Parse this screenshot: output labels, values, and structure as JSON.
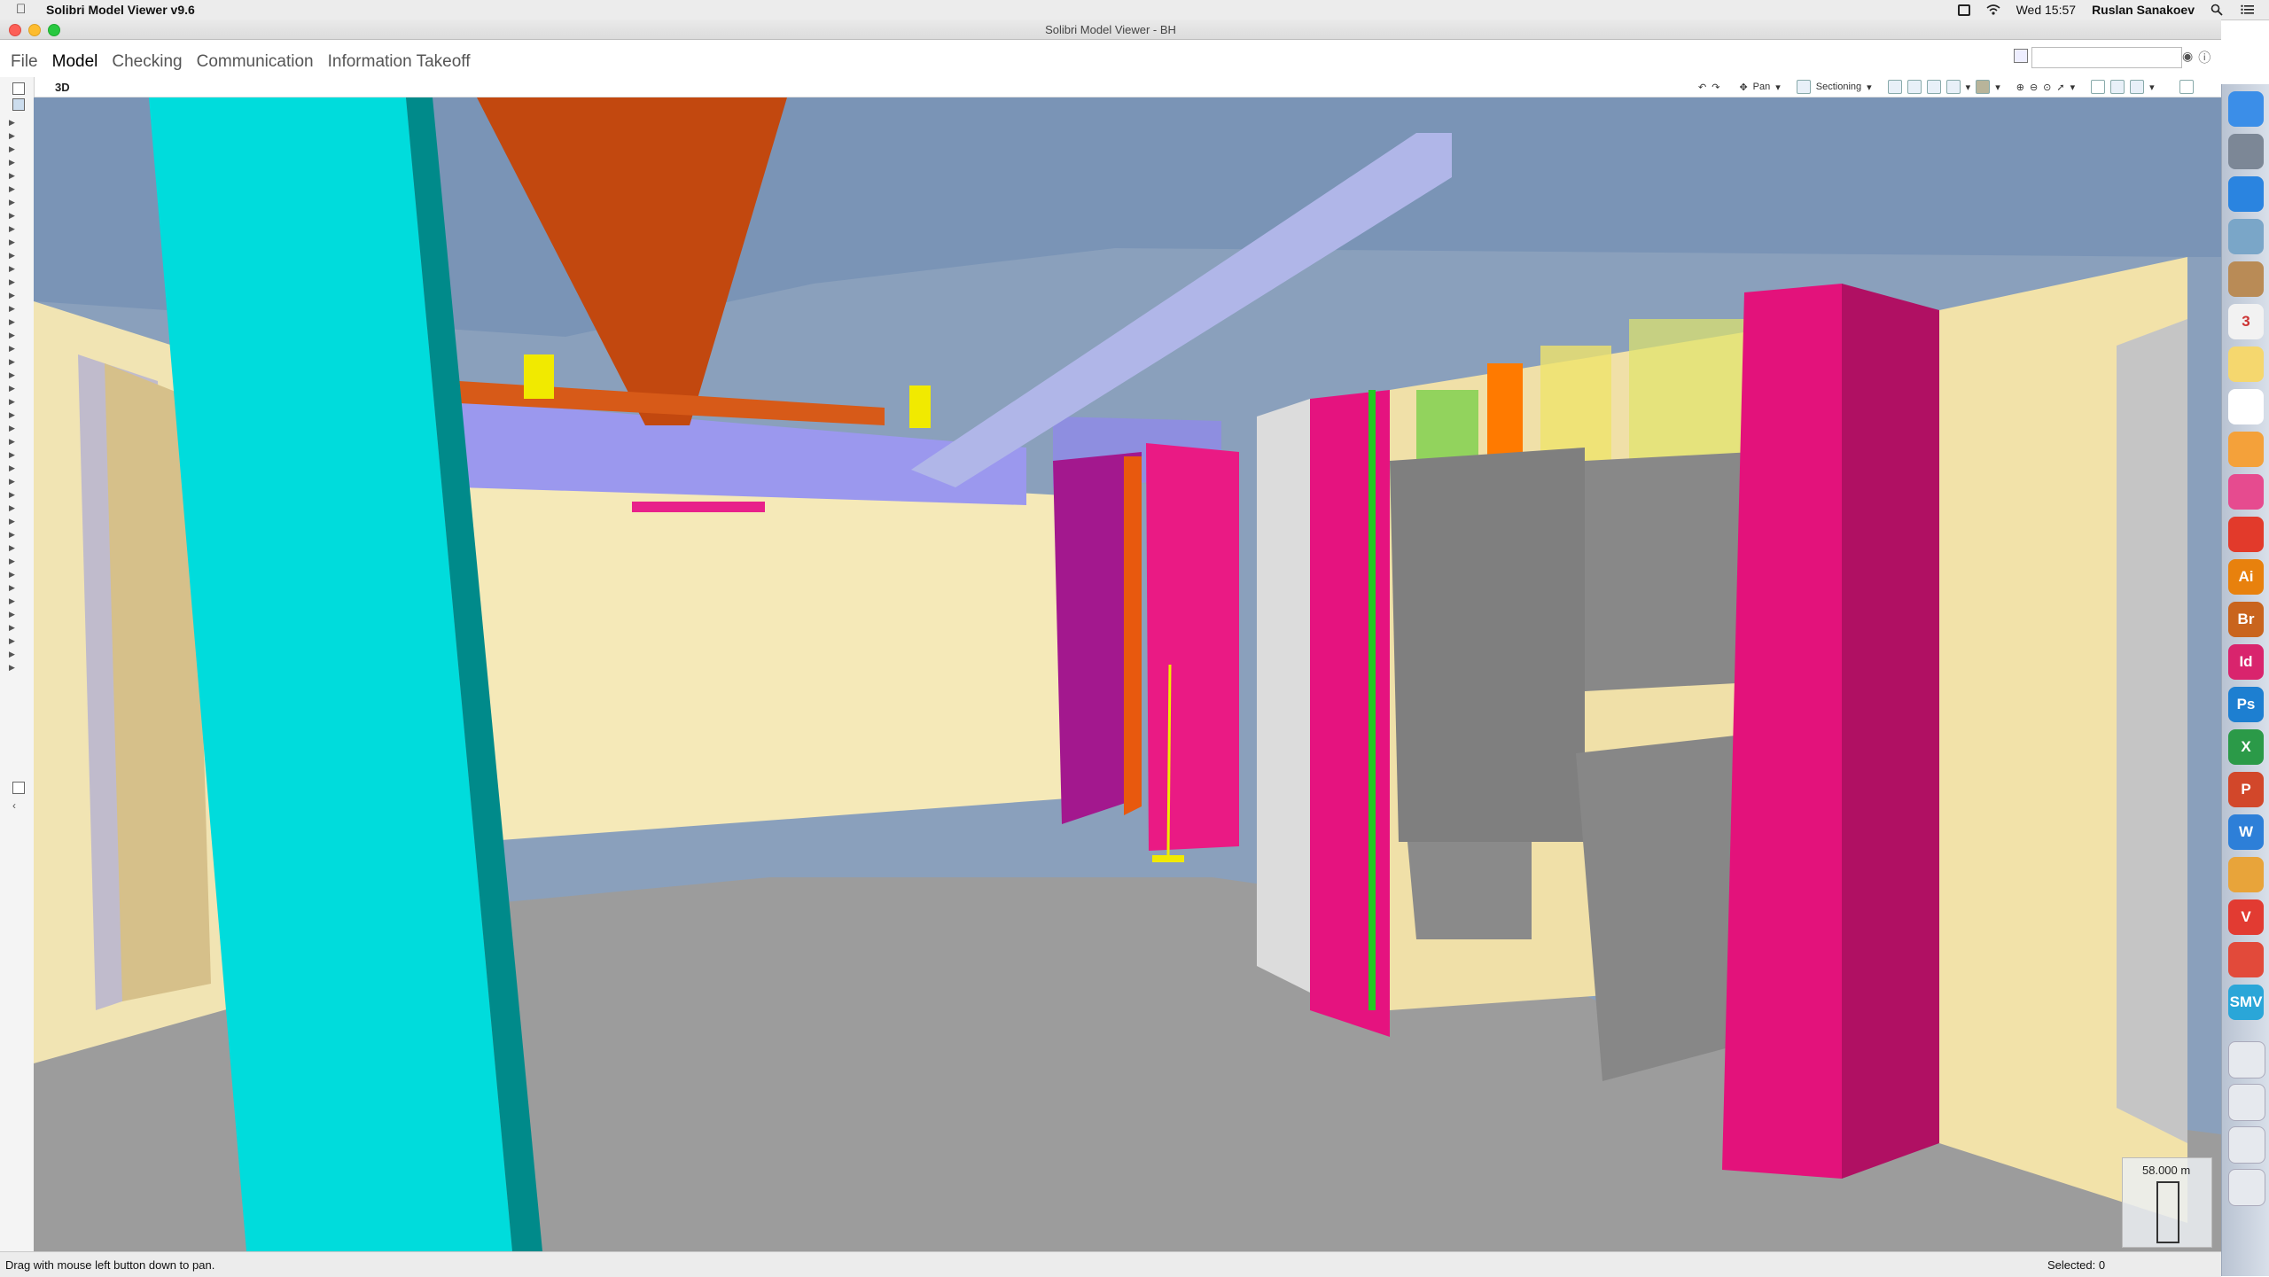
{
  "menubar": {
    "app_name": "Solibri Model Viewer v9.6",
    "clock": "Wed 15:57",
    "user": "Ruslan Sanakoev"
  },
  "window": {
    "title": "Solibri Model Viewer - BH"
  },
  "app_menu": {
    "items": [
      "File",
      "Model",
      "Checking",
      "Communication",
      "Information Takeoff"
    ],
    "active": "Model",
    "search_value": ""
  },
  "view": {
    "label": "3D",
    "pan_label": "Pan",
    "sectioning_label": "Sectioning"
  },
  "navigator": {
    "scale": "58.000 m"
  },
  "status": {
    "hint": "Drag with mouse left button down to pan.",
    "selected": "Selected: 0"
  },
  "dock": {
    "apps": [
      {
        "icon": "finder-icon",
        "text": "",
        "color": "#3b8ee8"
      },
      {
        "icon": "launchpad-icon",
        "text": "",
        "color": "#7c8796"
      },
      {
        "icon": "safari-icon",
        "text": "",
        "color": "#2a84e0"
      },
      {
        "icon": "preview-icon",
        "text": "",
        "color": "#7aa6c8"
      },
      {
        "icon": "contacts-icon",
        "text": "",
        "color": "#b98b56"
      },
      {
        "icon": "calendar-icon",
        "text": "3",
        "color": "#f2f2f2"
      },
      {
        "icon": "notes-icon",
        "text": "",
        "color": "#f5d76e"
      },
      {
        "icon": "reminders-icon",
        "text": "",
        "color": "#ffffff"
      },
      {
        "icon": "photos-icon",
        "text": "",
        "color": "#f4a13a"
      },
      {
        "icon": "itunes-icon",
        "text": "",
        "color": "#e64b8f"
      },
      {
        "icon": "acrobat-icon",
        "text": "",
        "color": "#e23a2b"
      },
      {
        "icon": "illustrator-icon",
        "text": "Ai",
        "color": "#e8810d"
      },
      {
        "icon": "bridge-icon",
        "text": "Br",
        "color": "#c9641d"
      },
      {
        "icon": "indesign-icon",
        "text": "Id",
        "color": "#d9246d"
      },
      {
        "icon": "photoshop-icon",
        "text": "Ps",
        "color": "#1d7fd1"
      },
      {
        "icon": "excel-icon",
        "text": "X",
        "color": "#2b9a48"
      },
      {
        "icon": "powerpoint-icon",
        "text": "P",
        "color": "#d2472a"
      },
      {
        "icon": "word-icon",
        "text": "W",
        "color": "#2d7fd8"
      },
      {
        "icon": "vectorworks-icon",
        "text": "",
        "color": "#e8a43a"
      },
      {
        "icon": "vivaldi-icon",
        "text": "V",
        "color": "#e23b32"
      },
      {
        "icon": "sketchup-icon",
        "text": "",
        "color": "#e24a3a"
      },
      {
        "icon": "solibri-icon",
        "text": "SMV",
        "color": "#2aa6d8"
      }
    ],
    "tail": [
      {
        "icon": "document-icon"
      },
      {
        "icon": "folder-icon"
      },
      {
        "icon": "download-icon"
      },
      {
        "icon": "trash-icon"
      }
    ]
  }
}
